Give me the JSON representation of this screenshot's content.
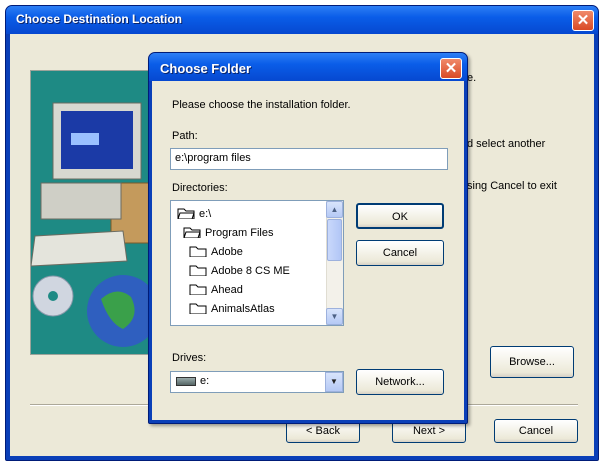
{
  "outer_window": {
    "title": "Choose Destination Location",
    "background_texts": [
      {
        "id": "bg-fragment-1",
        "text": "e."
      },
      {
        "id": "bg-fragment-2",
        "text": "d select another"
      },
      {
        "id": "bg-fragment-3",
        "text": "sing Cancel to exit"
      }
    ],
    "buttons": {
      "browse": "Browse...",
      "back": "< Back",
      "next": "Next >",
      "cancel": "Cancel"
    }
  },
  "folder_dialog": {
    "title": "Choose Folder",
    "instruction": "Please choose the installation folder.",
    "path_label": "Path:",
    "path_value": "e:\\program files",
    "directories_label": "Directories:",
    "directories": [
      {
        "name": "e:\\",
        "icon": "open-folder-icon",
        "indent": 0
      },
      {
        "name": "Program Files",
        "icon": "open-folder-icon",
        "indent": 1
      },
      {
        "name": "Adobe",
        "icon": "folder-icon",
        "indent": 2
      },
      {
        "name": "Adobe 8 CS ME",
        "icon": "folder-icon",
        "indent": 2
      },
      {
        "name": "Ahead",
        "icon": "folder-icon",
        "indent": 2
      },
      {
        "name": "AnimalsAtlas",
        "icon": "folder-icon",
        "indent": 2
      }
    ],
    "drives_label": "Drives:",
    "drive_value": "e:",
    "buttons": {
      "ok": "OK",
      "cancel": "Cancel",
      "network": "Network..."
    }
  },
  "colors": {
    "title_bar": "#0a5de8",
    "dialog_face": "#ece9d8",
    "close_button": "#d94a26",
    "picture_background": "#1e8a84"
  }
}
